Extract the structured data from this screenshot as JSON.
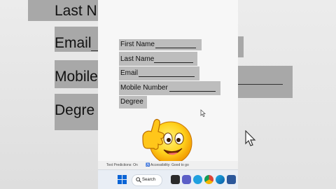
{
  "background": {
    "left_labels": [
      "Last N",
      "Email",
      "Mobile",
      "Degre"
    ]
  },
  "form": {
    "fields": [
      {
        "label": "First Name"
      },
      {
        "label": "Last Name"
      },
      {
        "label": "Email"
      },
      {
        "label": "Mobile Number"
      },
      {
        "label": "Degree"
      }
    ]
  },
  "statusbar": {
    "predictions": "Text Predictions: On",
    "accessibility": "Accessibility: Good to go"
  },
  "taskbar": {
    "search_label": "Search",
    "icons": [
      "windows-start-icon",
      "search-icon",
      "task-view-icon",
      "teams-icon",
      "edge-icon",
      "file-explorer-icon",
      "chrome-icon",
      "edge-browser-icon",
      "word-icon"
    ]
  },
  "colors": {
    "highlight": "#bdbdbd",
    "word_blue": "#2b579a",
    "taskbar": "#e9eef5"
  }
}
